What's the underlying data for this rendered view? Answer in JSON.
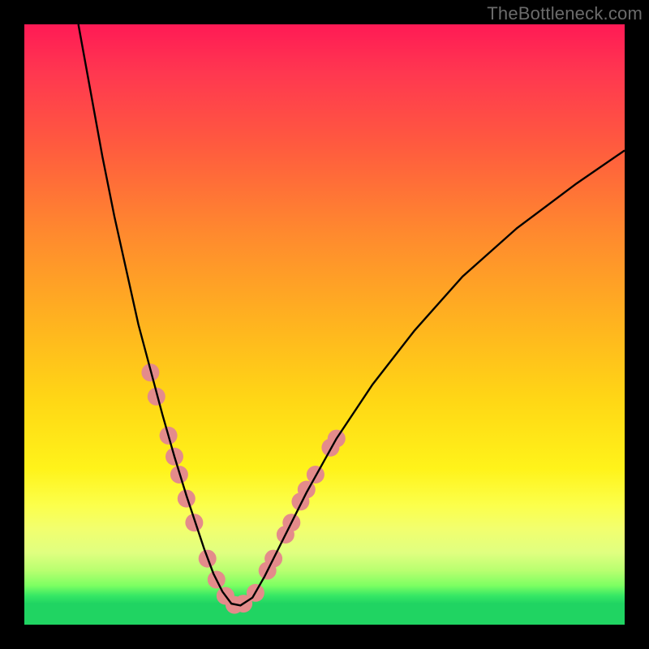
{
  "watermark": "TheBottleneck.com",
  "chart_data": {
    "type": "line",
    "title": "",
    "xlabel": "",
    "ylabel": "",
    "xlim": [
      0,
      100
    ],
    "ylim": [
      0,
      100
    ],
    "grid": false,
    "legend": false,
    "background_gradient": {
      "direction": "vertical",
      "stops": [
        {
          "pos": 0.0,
          "color": "#ff1a55"
        },
        {
          "pos": 0.35,
          "color": "#ff8a2e"
        },
        {
          "pos": 0.63,
          "color": "#ffd815"
        },
        {
          "pos": 0.8,
          "color": "#fcff4a"
        },
        {
          "pos": 0.95,
          "color": "#35e765"
        },
        {
          "pos": 1.0,
          "color": "#20d462"
        }
      ]
    },
    "series": [
      {
        "name": "bottleneck-curve",
        "color": "#000000",
        "x": [
          9,
          11,
          13,
          15,
          17,
          19,
          21,
          23,
          25,
          27,
          28.5,
          30,
          31.5,
          33,
          34.5,
          36,
          38,
          40,
          43,
          47,
          52,
          58,
          65,
          73,
          82,
          92,
          100
        ],
        "y": [
          100,
          89,
          78,
          68,
          59,
          50,
          42.5,
          35,
          28,
          21.5,
          17,
          12.5,
          8.5,
          5.5,
          3.5,
          3.2,
          4.5,
          8,
          14,
          22,
          31,
          40,
          49,
          58,
          66,
          73.5,
          79
        ]
      }
    ],
    "markers": {
      "name": "highlight-dots",
      "color": "#e48b8b",
      "radius_px": 11,
      "points": [
        {
          "x": 21.0,
          "y": 42.0
        },
        {
          "x": 22.0,
          "y": 38.0
        },
        {
          "x": 24.0,
          "y": 31.5
        },
        {
          "x": 25.0,
          "y": 28.0
        },
        {
          "x": 25.8,
          "y": 25.0
        },
        {
          "x": 27.0,
          "y": 21.0
        },
        {
          "x": 28.3,
          "y": 17.0
        },
        {
          "x": 30.5,
          "y": 11.0
        },
        {
          "x": 32.0,
          "y": 7.5
        },
        {
          "x": 33.5,
          "y": 4.8
        },
        {
          "x": 35.0,
          "y": 3.3
        },
        {
          "x": 36.5,
          "y": 3.5
        },
        {
          "x": 38.5,
          "y": 5.3
        },
        {
          "x": 40.5,
          "y": 9.0
        },
        {
          "x": 41.5,
          "y": 11.0
        },
        {
          "x": 43.5,
          "y": 15.0
        },
        {
          "x": 44.5,
          "y": 17.0
        },
        {
          "x": 46.0,
          "y": 20.5
        },
        {
          "x": 47.0,
          "y": 22.5
        },
        {
          "x": 48.5,
          "y": 25.0
        },
        {
          "x": 51.0,
          "y": 29.5
        },
        {
          "x": 52.0,
          "y": 31.0
        }
      ]
    }
  }
}
